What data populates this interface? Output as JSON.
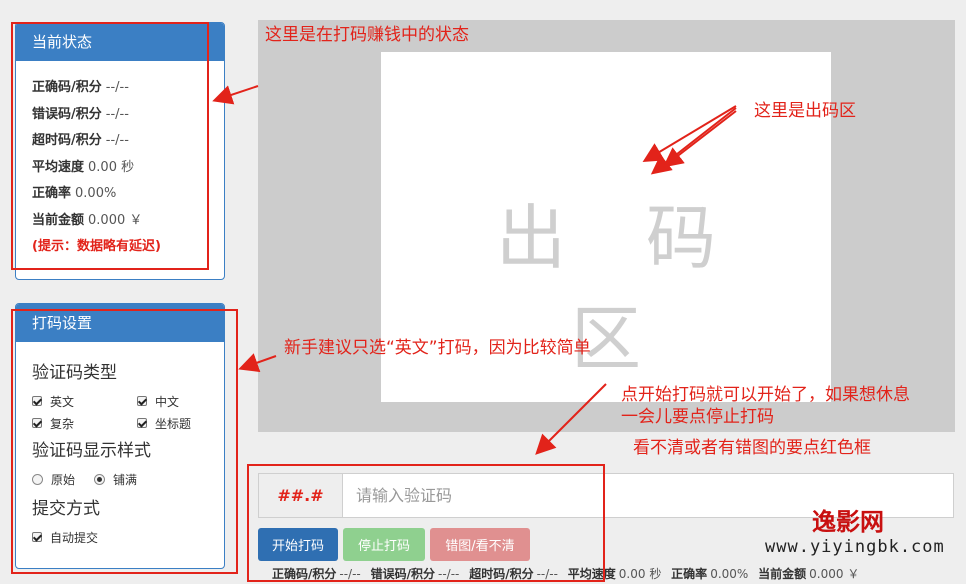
{
  "status": {
    "title": "当前状态",
    "rows": [
      {
        "label": "正确码/积分",
        "value": "--/--"
      },
      {
        "label": "错误码/积分",
        "value": "--/--"
      },
      {
        "label": "超时码/积分",
        "value": "--/--"
      },
      {
        "label": "平均速度",
        "value": "0.00 秒"
      },
      {
        "label": "正确率",
        "value": "0.00%"
      },
      {
        "label": "当前金额",
        "value": "0.000 ￥"
      }
    ],
    "hint": "(提示：数据略有延迟)"
  },
  "settings": {
    "title": "打码设置",
    "type_title": "验证码类型",
    "types": [
      "英文",
      "中文",
      "复杂",
      "坐标题"
    ],
    "style_title": "验证码显示样式",
    "styles": [
      "原始",
      "铺满"
    ],
    "style_selected": "铺满",
    "submit_title": "提交方式",
    "submit_option": "自动提交"
  },
  "code_area": {
    "placeholder_text": "出码区"
  },
  "input": {
    "addon": "##.#",
    "placeholder": "请输入验证码"
  },
  "buttons": {
    "start": "开始打码",
    "stop": "停止打码",
    "error": "错图/看不清"
  },
  "bottom_stats": [
    {
      "label": "正确码/积分",
      "value": "--/--"
    },
    {
      "label": "错误码/积分",
      "value": "--/--"
    },
    {
      "label": "超时码/积分",
      "value": "--/--"
    },
    {
      "label": "平均速度",
      "value": "0.00 秒"
    },
    {
      "label": "正确率",
      "value": "0.00%"
    },
    {
      "label": "当前金额",
      "value": "0.000 ￥"
    }
  ],
  "annotations": {
    "status_note": "这里是在打码赚钱中的状态",
    "area_note": "这里是出码区",
    "settings_note": "新手建议只选“英文”打码，因为比较简单",
    "start_note_1": "点开始打码就可以开始了，如果想休息",
    "start_note_2": "一会儿要点停止打码",
    "error_note": "看不清或者有错图的要点红色框"
  },
  "watermark": {
    "name": "逸影网",
    "url": "www.yiyingbk.com"
  },
  "colors": {
    "primary": "#3b7fc4",
    "annotation": "#e2231a",
    "stop": "#8fd08f",
    "error": "#e09090"
  }
}
